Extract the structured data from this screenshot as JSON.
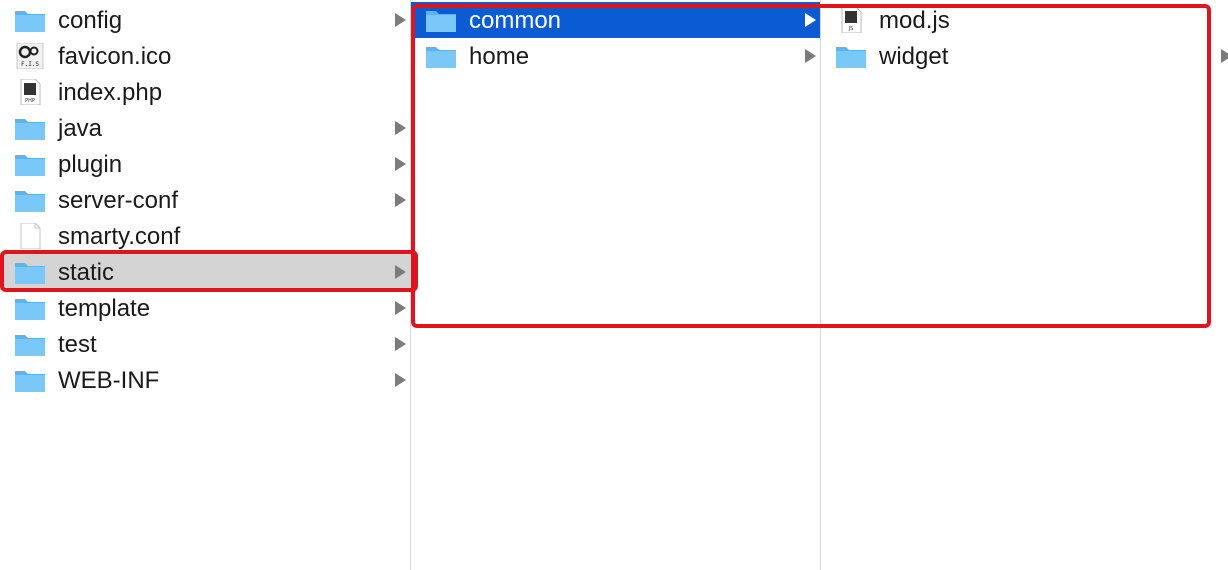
{
  "columns": {
    "col1": {
      "items": [
        {
          "label": "config",
          "type": "folder",
          "has_children": true
        },
        {
          "label": "favicon.ico",
          "type": "ico-file",
          "has_children": false
        },
        {
          "label": "index.php",
          "type": "php-file",
          "has_children": false
        },
        {
          "label": "java",
          "type": "folder",
          "has_children": true
        },
        {
          "label": "plugin",
          "type": "folder",
          "has_children": true
        },
        {
          "label": "server-conf",
          "type": "folder",
          "has_children": true
        },
        {
          "label": "smarty.conf",
          "type": "text-file",
          "has_children": false
        },
        {
          "label": "static",
          "type": "folder",
          "has_children": true,
          "selected": "gray"
        },
        {
          "label": "template",
          "type": "folder",
          "has_children": true
        },
        {
          "label": "test",
          "type": "folder",
          "has_children": true
        },
        {
          "label": "WEB-INF",
          "type": "folder",
          "has_children": true
        }
      ]
    },
    "col2": {
      "items": [
        {
          "label": "common",
          "type": "folder",
          "has_children": true,
          "selected": "blue"
        },
        {
          "label": "home",
          "type": "folder",
          "has_children": true
        }
      ]
    },
    "col3": {
      "items": [
        {
          "label": "mod.js",
          "type": "js-file",
          "has_children": false
        },
        {
          "label": "widget",
          "type": "folder",
          "has_children": true
        }
      ]
    }
  },
  "icon_glyphs": {
    "favicon_text": "F.I.S",
    "php_text": "PHP",
    "js_text": "JS"
  },
  "colors": {
    "folder": "#6cc0f5",
    "selection_blue": "#0b5bd3",
    "selection_gray": "#d4d4d4",
    "annotation_red": "#e0141e"
  }
}
